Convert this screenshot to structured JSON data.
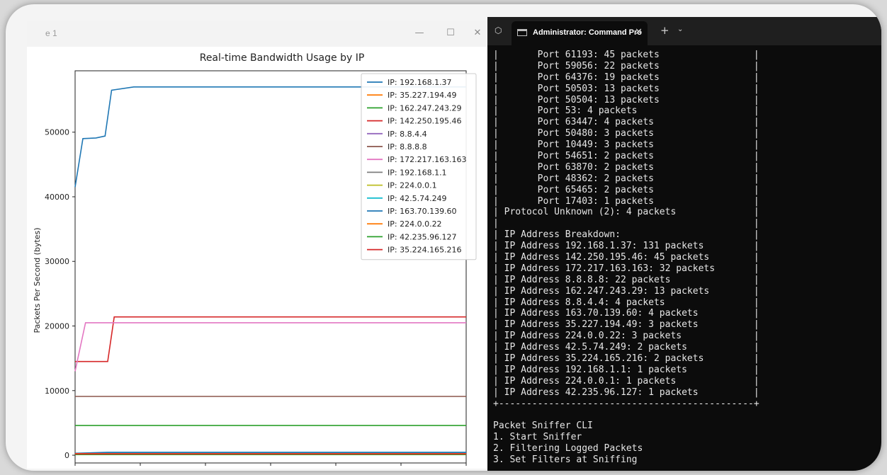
{
  "plot_window": {
    "title_fragment": "e 1",
    "minimize": "—",
    "maximize": "☐",
    "close": "✕"
  },
  "chart_data": {
    "type": "line",
    "title": "Real-time Bandwidth Usage by IP",
    "xlabel": "",
    "ylabel": "Packets Per Second (bytes)",
    "ylim": [
      -1200,
      59500
    ],
    "yticks": [
      0,
      10000,
      20000,
      30000,
      40000,
      50000
    ],
    "ytick_labels": [
      "0",
      "10000",
      "20000",
      "30000",
      "40000",
      "50000"
    ],
    "xlim": [
      0,
      30
    ],
    "xticks": [
      0,
      5,
      10,
      15,
      20,
      25,
      30
    ],
    "legend_position": "upper-right",
    "series": [
      {
        "name": "IP: 192.168.1.37",
        "color": "#1f77b4",
        "x": [
          0,
          0.6,
          1.6,
          2.3,
          2.8,
          4.5,
          30
        ],
        "y": [
          41500,
          49000,
          49100,
          49400,
          56500,
          57000,
          57000
        ]
      },
      {
        "name": "IP: 35.227.194.49",
        "color": "#ff7f0e",
        "x": [
          0,
          30
        ],
        "y": [
          200,
          200
        ]
      },
      {
        "name": "IP: 162.247.243.29",
        "color": "#2ca02c",
        "x": [
          0,
          30
        ],
        "y": [
          4600,
          4600
        ]
      },
      {
        "name": "IP: 142.250.195.46",
        "color": "#d62728",
        "x": [
          0,
          2.5,
          3,
          30
        ],
        "y": [
          14500,
          14500,
          21400,
          21400
        ]
      },
      {
        "name": "IP: 8.8.4.4",
        "color": "#9467bd",
        "x": [
          0,
          30
        ],
        "y": [
          150,
          150
        ]
      },
      {
        "name": "IP: 8.8.8.8",
        "color": "#8c564b",
        "x": [
          0,
          30
        ],
        "y": [
          9100,
          9100
        ]
      },
      {
        "name": "IP: 172.217.163.163",
        "color": "#e377c2",
        "x": [
          0,
          0.8,
          30
        ],
        "y": [
          13000,
          20500,
          20500
        ]
      },
      {
        "name": "IP: 192.168.1.1",
        "color": "#7f7f7f",
        "x": [
          0,
          30
        ],
        "y": [
          100,
          100
        ]
      },
      {
        "name": "IP: 224.0.0.1",
        "color": "#bcbd22",
        "x": [
          0,
          30
        ],
        "y": [
          100,
          100
        ]
      },
      {
        "name": "IP: 42.5.74.249",
        "color": "#17becf",
        "x": [
          0,
          2.5,
          30
        ],
        "y": [
          250,
          400,
          400
        ]
      },
      {
        "name": "IP: 163.70.139.60",
        "color": "#1f77b4",
        "x": [
          0,
          2.5,
          30
        ],
        "y": [
          300,
          450,
          450
        ]
      },
      {
        "name": "IP: 224.0.0.22",
        "color": "#ff7f0e",
        "x": [
          0,
          30
        ],
        "y": [
          250,
          250
        ]
      },
      {
        "name": "IP: 42.235.96.127",
        "color": "#2ca02c",
        "x": [
          0,
          30
        ],
        "y": [
          100,
          100
        ]
      },
      {
        "name": "IP: 35.224.165.216",
        "color": "#d62728",
        "x": [
          0,
          30
        ],
        "y": [
          200,
          200
        ]
      }
    ]
  },
  "terminal": {
    "tab_title": "Administrator: Command Pro",
    "tab_close": "✕",
    "new_tab": "+",
    "dropdown": "⌄",
    "shield": "⬡",
    "lines": [
      "|       Port 61193: 45 packets                 |",
      "|       Port 59056: 22 packets                 |",
      "|       Port 64376: 19 packets                 |",
      "|       Port 50503: 13 packets                 |",
      "|       Port 50504: 13 packets                 |",
      "|       Port 53: 4 packets                     |",
      "|       Port 63447: 4 packets                  |",
      "|       Port 50480: 3 packets                  |",
      "|       Port 10449: 3 packets                  |",
      "|       Port 54651: 2 packets                  |",
      "|       Port 63870: 2 packets                  |",
      "|       Port 48362: 2 packets                  |",
      "|       Port 65465: 2 packets                  |",
      "|       Port 17403: 1 packets                  |",
      "| Protocol Unknown (2): 4 packets              |",
      "|                                              |",
      "| IP Address Breakdown:                        |",
      "| IP Address 192.168.1.37: 131 packets         |",
      "| IP Address 142.250.195.46: 45 packets        |",
      "| IP Address 172.217.163.163: 32 packets       |",
      "| IP Address 8.8.8.8: 22 packets               |",
      "| IP Address 162.247.243.29: 13 packets        |",
      "| IP Address 8.8.4.4: 4 packets                |",
      "| IP Address 163.70.139.60: 4 packets          |",
      "| IP Address 35.227.194.49: 3 packets          |",
      "| IP Address 224.0.0.22: 3 packets             |",
      "| IP Address 42.5.74.249: 2 packets            |",
      "| IP Address 35.224.165.216: 2 packets         |",
      "| IP Address 192.168.1.1: 1 packets            |",
      "| IP Address 224.0.0.1: 1 packets              |",
      "| IP Address 42.235.96.127: 1 packets          |",
      "+----------------------------------------------+",
      "",
      "Packet Sniffer CLI",
      "1. Start Sniffer",
      "2. Filtering Logged Packets",
      "3. Set Filters at Sniffing"
    ]
  }
}
